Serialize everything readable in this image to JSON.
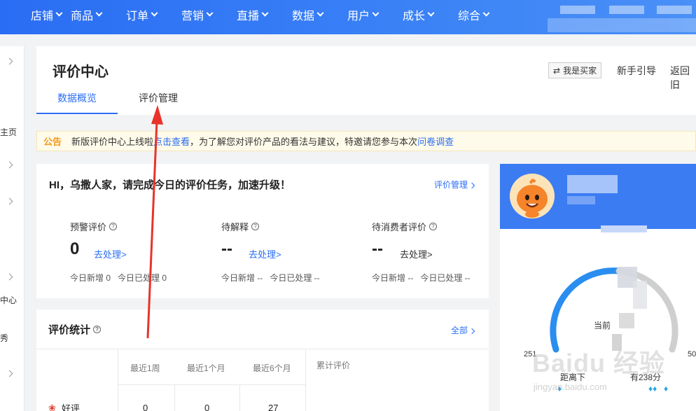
{
  "nav": {
    "items": [
      "店铺",
      "商品",
      "订单",
      "营销",
      "直播",
      "数据",
      "用户",
      "成长",
      "综合"
    ]
  },
  "sidebar": {
    "fragments": [
      "主页",
      "中心",
      "秀"
    ]
  },
  "header": {
    "title": "评价中心",
    "tabs": [
      "数据概览",
      "评价管理"
    ],
    "buyer_button": "我是买家",
    "links": [
      "新手引导",
      "返回旧"
    ]
  },
  "notice": {
    "tag": "公告",
    "text_before": "新版评价中心上线啦",
    "link1": "点击查看",
    "text_after": "，为了解您对评价产品的看法与建议，特邀请您参与本次",
    "link2": "问卷调查"
  },
  "task": {
    "title": "HI，乌撒人家，请完成今日的评价任务，加速升级！",
    "manage_link": "评价管理",
    "metrics": [
      {
        "label": "预警评价",
        "value": "0",
        "action": "去处理>",
        "action_active": true,
        "sub_new": "今日新增 0",
        "sub_done": "今日已处理 0"
      },
      {
        "label": "待解释",
        "value": "--",
        "action": "去处理>",
        "action_active": true,
        "sub_new": "今日新增 --",
        "sub_done": "今日已处理 --"
      },
      {
        "label": "待消费者评价",
        "value": "--",
        "action": "去处理>",
        "action_active": false,
        "sub_new": "今日新增 --",
        "sub_done": "今日已处理 --"
      }
    ]
  },
  "stats": {
    "title": "评价统计",
    "all_link": "全部",
    "columns": [
      "最近1周",
      "最近1个月",
      "最近6个月",
      "累计评价"
    ],
    "rows": [
      {
        "label": "好评",
        "values": [
          "0",
          "0",
          "27"
        ]
      }
    ]
  },
  "profile": {
    "current_label": "当前",
    "min": "251",
    "max": "50",
    "distance_text": "距离下",
    "score_text": "有238分"
  },
  "watermark": {
    "main": "Baidu 经验",
    "sub": "jingyan.baidu.com"
  },
  "colors": {
    "nav_bg": "#2a6df4",
    "accent": "#2a6df4",
    "notice_tag": "#f39a1e",
    "arrow": "#e8332a"
  }
}
